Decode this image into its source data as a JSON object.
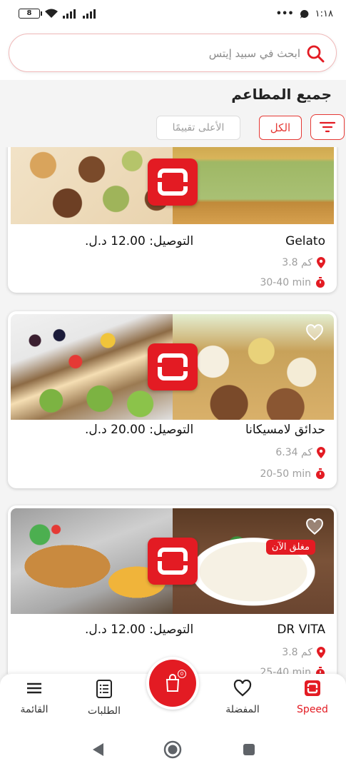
{
  "status_bar": {
    "time": "١:١٨",
    "battery": "8"
  },
  "search": {
    "placeholder": "ابحث في سبيد إيتس"
  },
  "section_title": "جميع المطاعم",
  "filters": {
    "all": "الكل",
    "top_rated": "الأعلى تقييمًا"
  },
  "restaurants": [
    {
      "name": "Gelato",
      "delivery": "التوصيل: 12.00 د.ل.",
      "distance": "3.8 كم",
      "time": "30-40 min",
      "closed": ""
    },
    {
      "name": "حدائق لامسيكانا",
      "delivery": "التوصيل: 20.00 د.ل.",
      "distance": "6.34 كم",
      "time": "20-50 min",
      "closed": ""
    },
    {
      "name": "DR VITA",
      "delivery": "التوصيل: 12.00 د.ل.",
      "distance": "3.8 كم",
      "time": "25-40 min",
      "closed": "مغلق الآن"
    }
  ],
  "bottom_nav": {
    "speed": "Speed",
    "favorites": "المفضلة",
    "orders": "الطلبات",
    "menu": "القائمة",
    "cart_count": "0"
  },
  "colors": {
    "accent": "#e31b23",
    "muted": "#9e9e9e"
  }
}
